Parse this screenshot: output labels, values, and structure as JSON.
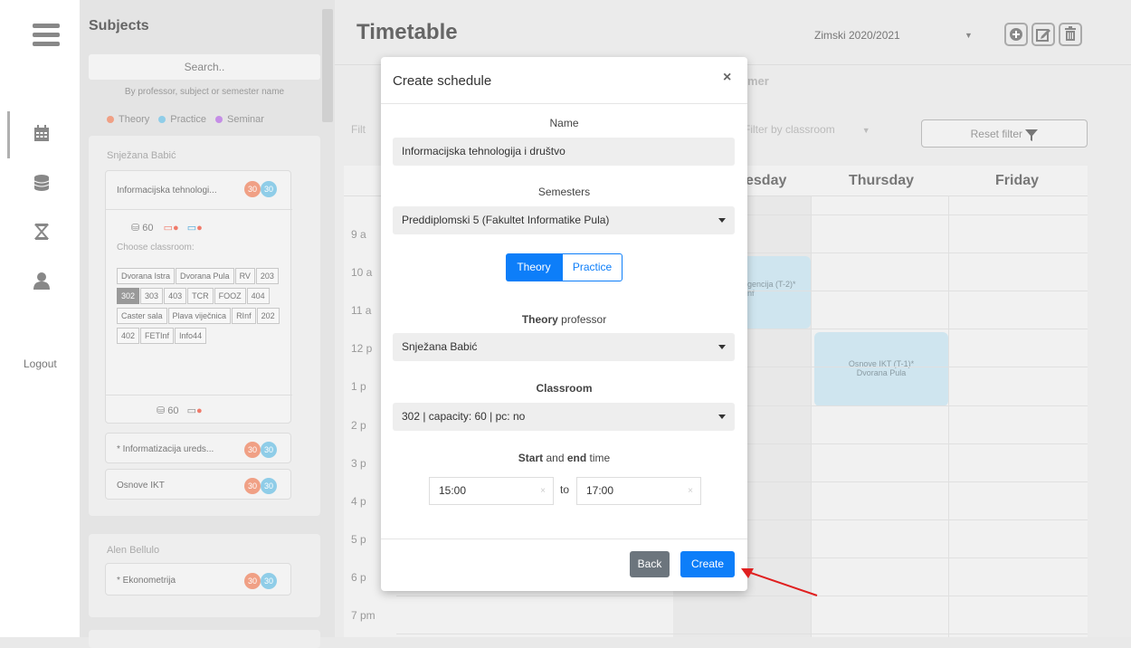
{
  "sidebar": {
    "items": [
      {
        "icon": "hamburger-icon"
      },
      {
        "icon": "calendar-icon",
        "active": true
      },
      {
        "icon": "database-icon"
      },
      {
        "icon": "hourglass-icon"
      },
      {
        "icon": "user-icon"
      }
    ],
    "logout": "Logout"
  },
  "subjects": {
    "title": "Subjects",
    "search_placeholder": "Search..",
    "search_hint": "By professor, subject or semester name",
    "legend": [
      {
        "label": "Theory",
        "color": "#f0a085"
      },
      {
        "label": "Practice",
        "color": "#8fcde8"
      },
      {
        "label": "Seminar",
        "color": "#c58ee6"
      }
    ],
    "professors": [
      {
        "name": "Snježana Babić",
        "courses": [
          {
            "name": "Informacijska tehnologi...",
            "theory": "30",
            "practice": "30"
          },
          {
            "name": "* Informatizacija ureds...",
            "theory": "30",
            "practice": "30"
          },
          {
            "name": "Osnove IKT",
            "theory": "30",
            "practice": "30"
          }
        ],
        "capacity": "60",
        "capacity2": "60",
        "choose_classroom": "Choose classroom:",
        "rooms": [
          "Dvorana Istra",
          "Dvorana Pula",
          "RV",
          "203",
          "302",
          "303",
          "403",
          "TCR",
          "FOOZ",
          "404",
          "Caster sala",
          "Plava viječnica",
          "RInf",
          "202",
          "402",
          "FETInf",
          "Info44"
        ]
      },
      {
        "name": "Alen Bellulo",
        "courses": [
          {
            "name": "* Ekonometrija",
            "theory": "30",
            "practice": "30"
          }
        ]
      }
    ]
  },
  "timetable": {
    "title": "Timetable",
    "semester": "Zimski 2020/2021",
    "tab_partial": "mer",
    "filter_left": "Filt",
    "filter_classroom": "Filter by classroom",
    "reset_filter": "Reset filter",
    "days_visible": [
      "esday",
      "Thursday",
      "Friday"
    ],
    "times": [
      "9 a",
      "10 a",
      "11 a",
      "12 p",
      "1 p",
      "2 p",
      "3 p",
      "4 p",
      "5 p",
      "6 p",
      "7 pm"
    ],
    "events": [
      {
        "line1": "gencija (T-2)*",
        "line2": "nf"
      },
      {
        "line1": "Osnove IKT (T-1)*",
        "line2": "Dvorana Pula"
      }
    ]
  },
  "modal": {
    "title": "Create schedule",
    "close": "×",
    "name_label": "Name",
    "name_value": "Informacijska tehnologija i društvo",
    "semesters_label": "Semesters",
    "semester_value": "Preddiplomski 5 (Fakultet Informatike Pula)",
    "toggle_theory": "Theory",
    "toggle_practice": "Practice",
    "professor_label_bold": "Theory",
    "professor_label_rest": " professor",
    "professor_value": "Snježana Babić",
    "classroom_label": "Classroom",
    "classroom_value": "302 | capacity: 60 | pc: no",
    "time_label_start": "Start",
    "time_label_and": " and ",
    "time_label_end": "end",
    "time_label_rest": " time",
    "start_time": "15:00",
    "to": "to",
    "end_time": "17:00",
    "clear": "×",
    "back": "Back",
    "create": "Create"
  },
  "colors": {
    "primary": "#0d7ef9",
    "secondary": "#6c757d",
    "arrow": "#e01f1f"
  }
}
